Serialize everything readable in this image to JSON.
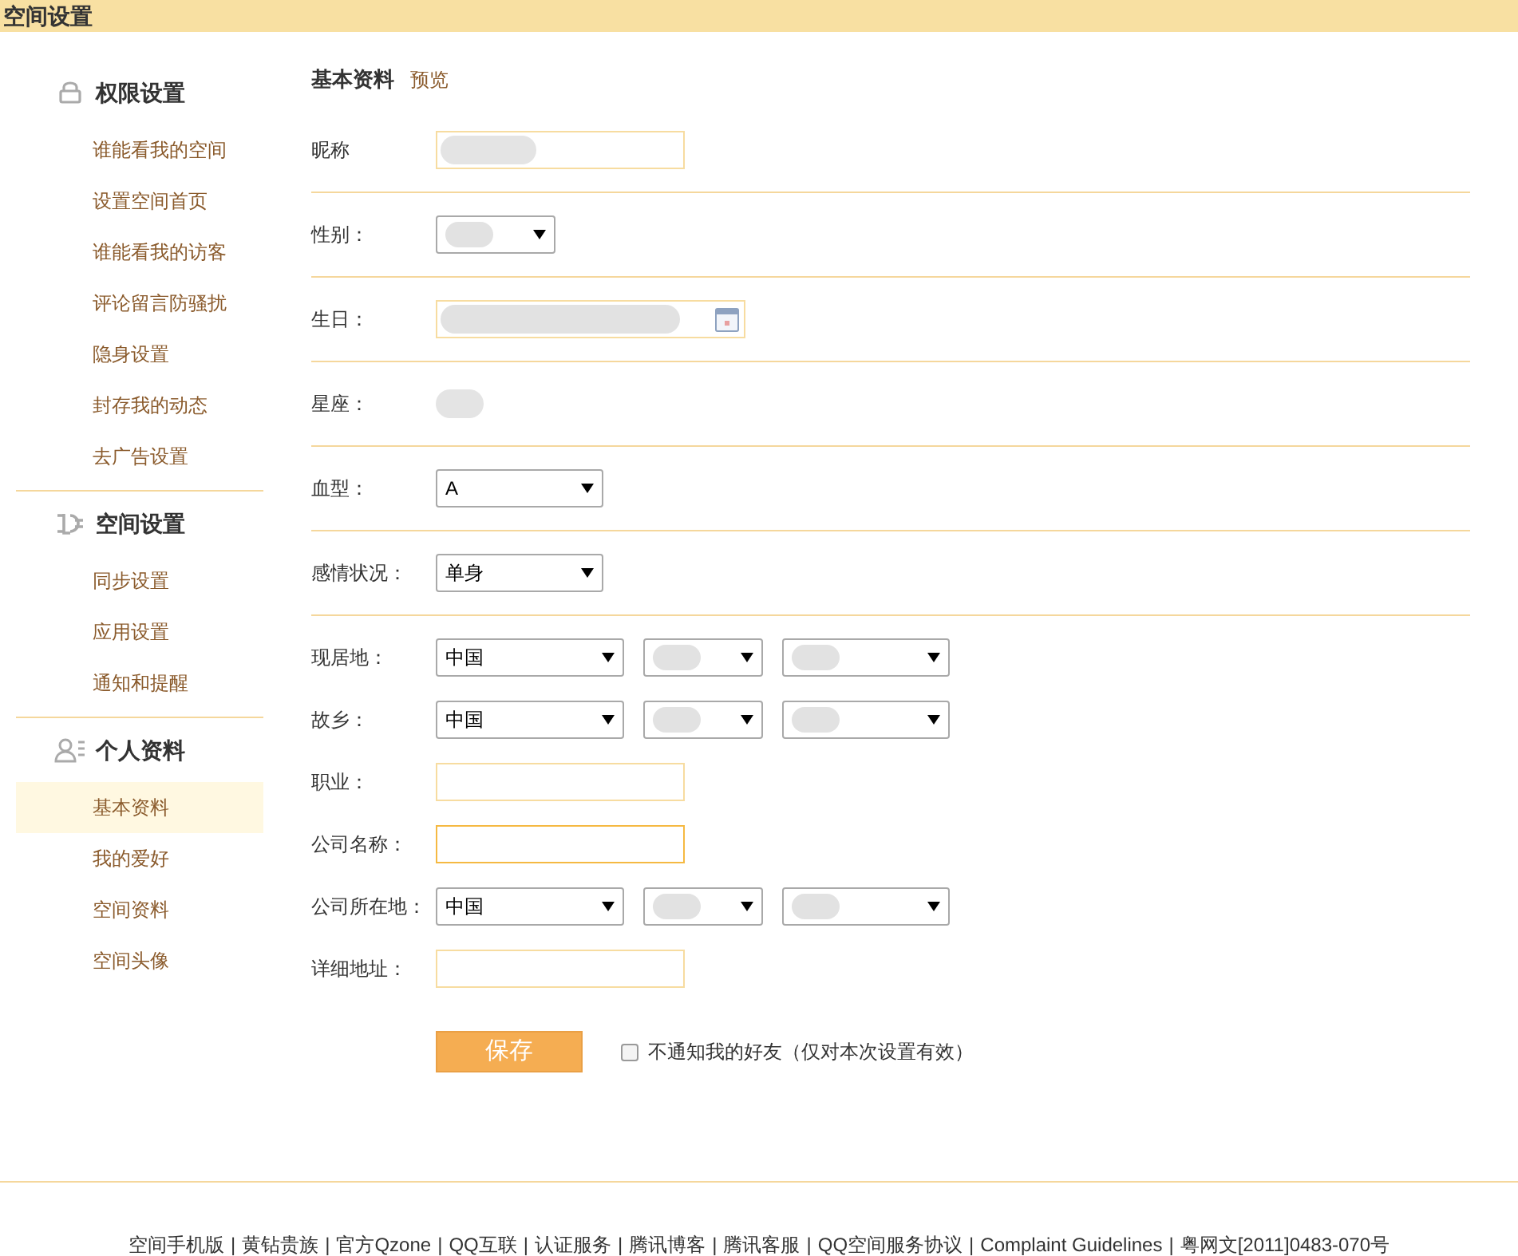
{
  "header": {
    "title": "空间设置"
  },
  "sidebar": {
    "sections": [
      {
        "title": "权限设置",
        "items": [
          {
            "label": "谁能看我的空间",
            "selected": false
          },
          {
            "label": "设置空间首页",
            "selected": false
          },
          {
            "label": "谁能看我的访客",
            "selected": false
          },
          {
            "label": "评论留言防骚扰",
            "selected": false
          },
          {
            "label": "隐身设置",
            "selected": false
          },
          {
            "label": "封存我的动态",
            "selected": false
          },
          {
            "label": "去广告设置",
            "selected": false
          }
        ]
      },
      {
        "title": "空间设置",
        "items": [
          {
            "label": "同步设置",
            "selected": false
          },
          {
            "label": "应用设置",
            "selected": false
          },
          {
            "label": "通知和提醒",
            "selected": false
          }
        ]
      },
      {
        "title": "个人资料",
        "items": [
          {
            "label": "基本资料",
            "selected": true
          },
          {
            "label": "我的爱好",
            "selected": false
          },
          {
            "label": "空间资料",
            "selected": false
          },
          {
            "label": "空间头像",
            "selected": false
          }
        ]
      }
    ]
  },
  "content": {
    "tabs": [
      {
        "label": "基本资料",
        "selected": true
      },
      {
        "label": "预览",
        "selected": false
      }
    ],
    "groups": [
      [
        {
          "label": "昵称",
          "kind": "text",
          "blurred": true,
          "focused": false
        }
      ],
      [
        {
          "label": "性别：",
          "kind": "select",
          "selects": [
            {
              "blurred": true
            }
          ]
        }
      ],
      [
        {
          "label": "生日：",
          "kind": "date",
          "blurred": true
        }
      ],
      [
        {
          "label": "星座：",
          "kind": "static",
          "blurred": true
        }
      ],
      [
        {
          "label": "血型：",
          "kind": "select",
          "selects": [
            {
              "value": "A"
            }
          ]
        }
      ],
      [
        {
          "label": "感情状况：",
          "kind": "select",
          "selects": [
            {
              "value": "单身"
            }
          ]
        }
      ],
      [
        {
          "label": "现居地：",
          "kind": "select",
          "selects": [
            {
              "value": "中国"
            },
            {
              "blurred": true
            },
            {
              "blurred": true
            }
          ]
        },
        {
          "label": "故乡：",
          "kind": "select",
          "selects": [
            {
              "value": "中国"
            },
            {
              "blurred": true
            },
            {
              "blurred": true
            }
          ]
        },
        {
          "label": "职业：",
          "kind": "text",
          "focused": false
        },
        {
          "label": "公司名称：",
          "kind": "text",
          "focused": true
        },
        {
          "label": "公司所在地：",
          "kind": "select",
          "selects": [
            {
              "value": "中国"
            },
            {
              "blurred": true
            },
            {
              "blurred": true
            }
          ]
        },
        {
          "label": "详细地址：",
          "kind": "text",
          "focused": false
        }
      ]
    ],
    "save_button": "保存",
    "notify_checkbox": {
      "label": "不通知我的好友（仅对本次设置有效）",
      "checked": false
    }
  },
  "footer": {
    "separator": "|",
    "links": [
      "空间手机版",
      "黄钻贵族",
      "官方Qzone",
      "QQ互联",
      "认证服务",
      "腾讯博客",
      "腾讯客服",
      "QQ空间服务协议",
      "Complaint Guidelines",
      "粤网文[2011]0483-070号"
    ]
  }
}
